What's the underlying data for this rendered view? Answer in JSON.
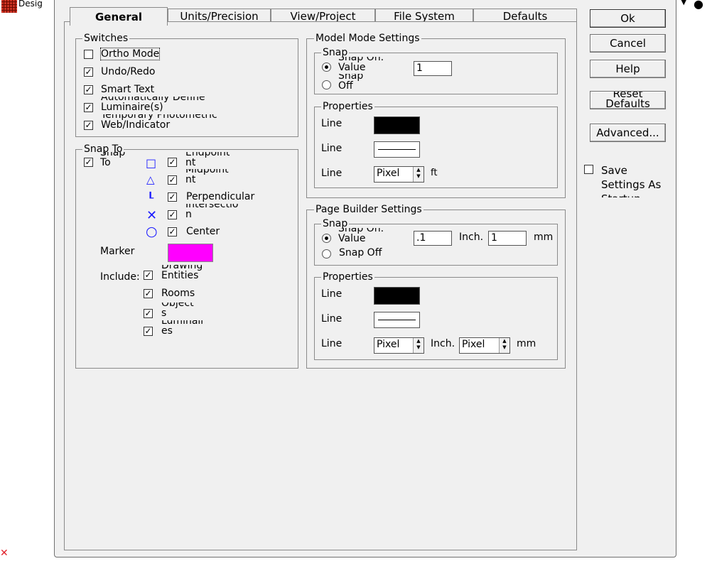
{
  "app": {
    "title_fragment": "Desig"
  },
  "tabs": [
    "General",
    "Units/Precision",
    "View/Project",
    "File System",
    "Defaults"
  ],
  "switches": {
    "legend": "Switches",
    "items": [
      {
        "label": "Ortho Mode",
        "checked": false,
        "label2": ""
      },
      {
        "label": "Undo/Redo",
        "checked": true,
        "label2": ""
      },
      {
        "label": "Smart Text",
        "checked": true,
        "label2": ""
      },
      {
        "label": "Automatically Define",
        "checked": true,
        "label2": "Luminaire(s)"
      },
      {
        "label": "Temporary Photometric",
        "checked": true,
        "label2": "Web/Indicator"
      }
    ]
  },
  "snap_to": {
    "legend": "Snap To",
    "master": {
      "label": "Snap",
      "label2": "To",
      "checked": true
    },
    "items": [
      {
        "label": "Endpoint",
        "label2": "nt",
        "checked": true,
        "icon": "square-icon"
      },
      {
        "label": "Midpoint",
        "label2": "nt",
        "checked": true,
        "icon": "triangle-icon"
      },
      {
        "label": "Perpendicular",
        "label2": "",
        "checked": true,
        "icon": "perpendicular-icon"
      },
      {
        "label": "Intersectio",
        "label2": "n",
        "checked": true,
        "icon": "x-icon"
      },
      {
        "label": "Center",
        "label2": "",
        "checked": true,
        "icon": "circle-icon"
      }
    ],
    "marker_label": "Marker",
    "marker_color": "#ff00ff",
    "include_label": "Include:",
    "include_items": [
      {
        "label": "Drawing",
        "label2": "Entities",
        "checked": true
      },
      {
        "label": "Rooms",
        "label2": "",
        "checked": true
      },
      {
        "label": "Object",
        "label2": "s",
        "checked": true
      },
      {
        "label": "Luminair",
        "label2": "es",
        "checked": true
      }
    ]
  },
  "model_mode": {
    "legend": "Model Mode Settings",
    "snap_legend": "Snap",
    "snap_on_label": "Snap On.",
    "snap_on_label2": "Value",
    "snap_off_label": "Snap",
    "snap_off_label2": "Off",
    "snap_value": "1",
    "props_legend": "Properties",
    "line1_label": "Line",
    "line2_label": "Line",
    "line3_label": "Line",
    "line_color": "#000000",
    "line_width_value": "Pixel",
    "unit": "ft"
  },
  "page_builder": {
    "legend": "Page Builder Settings",
    "snap_legend": "Snap",
    "snap_on_label": "Snap On.",
    "snap_on_label2": "Value",
    "snap_off_label": "Snap Off",
    "snap_value_inch": ".1",
    "inch_label": "Inch.",
    "snap_value_mm": "1",
    "mm_label": "mm",
    "props_legend": "Properties",
    "line1_label": "Line",
    "line2_label": "Line",
    "line3_label": "Line",
    "line_color": "#000000",
    "width_inch_value": "Pixel",
    "width_mm_value": "Pixel",
    "inch_label2": "Inch.",
    "mm_label2": "mm"
  },
  "buttons": {
    "ok": "Ok",
    "cancel": "Cancel",
    "help": "Help",
    "reset": "Reset",
    "reset2": "Defaults",
    "advanced": "Advanced..."
  },
  "save_settings": {
    "line1": "Save",
    "line2": "Settings As",
    "line3": "Startup",
    "checked": false
  }
}
